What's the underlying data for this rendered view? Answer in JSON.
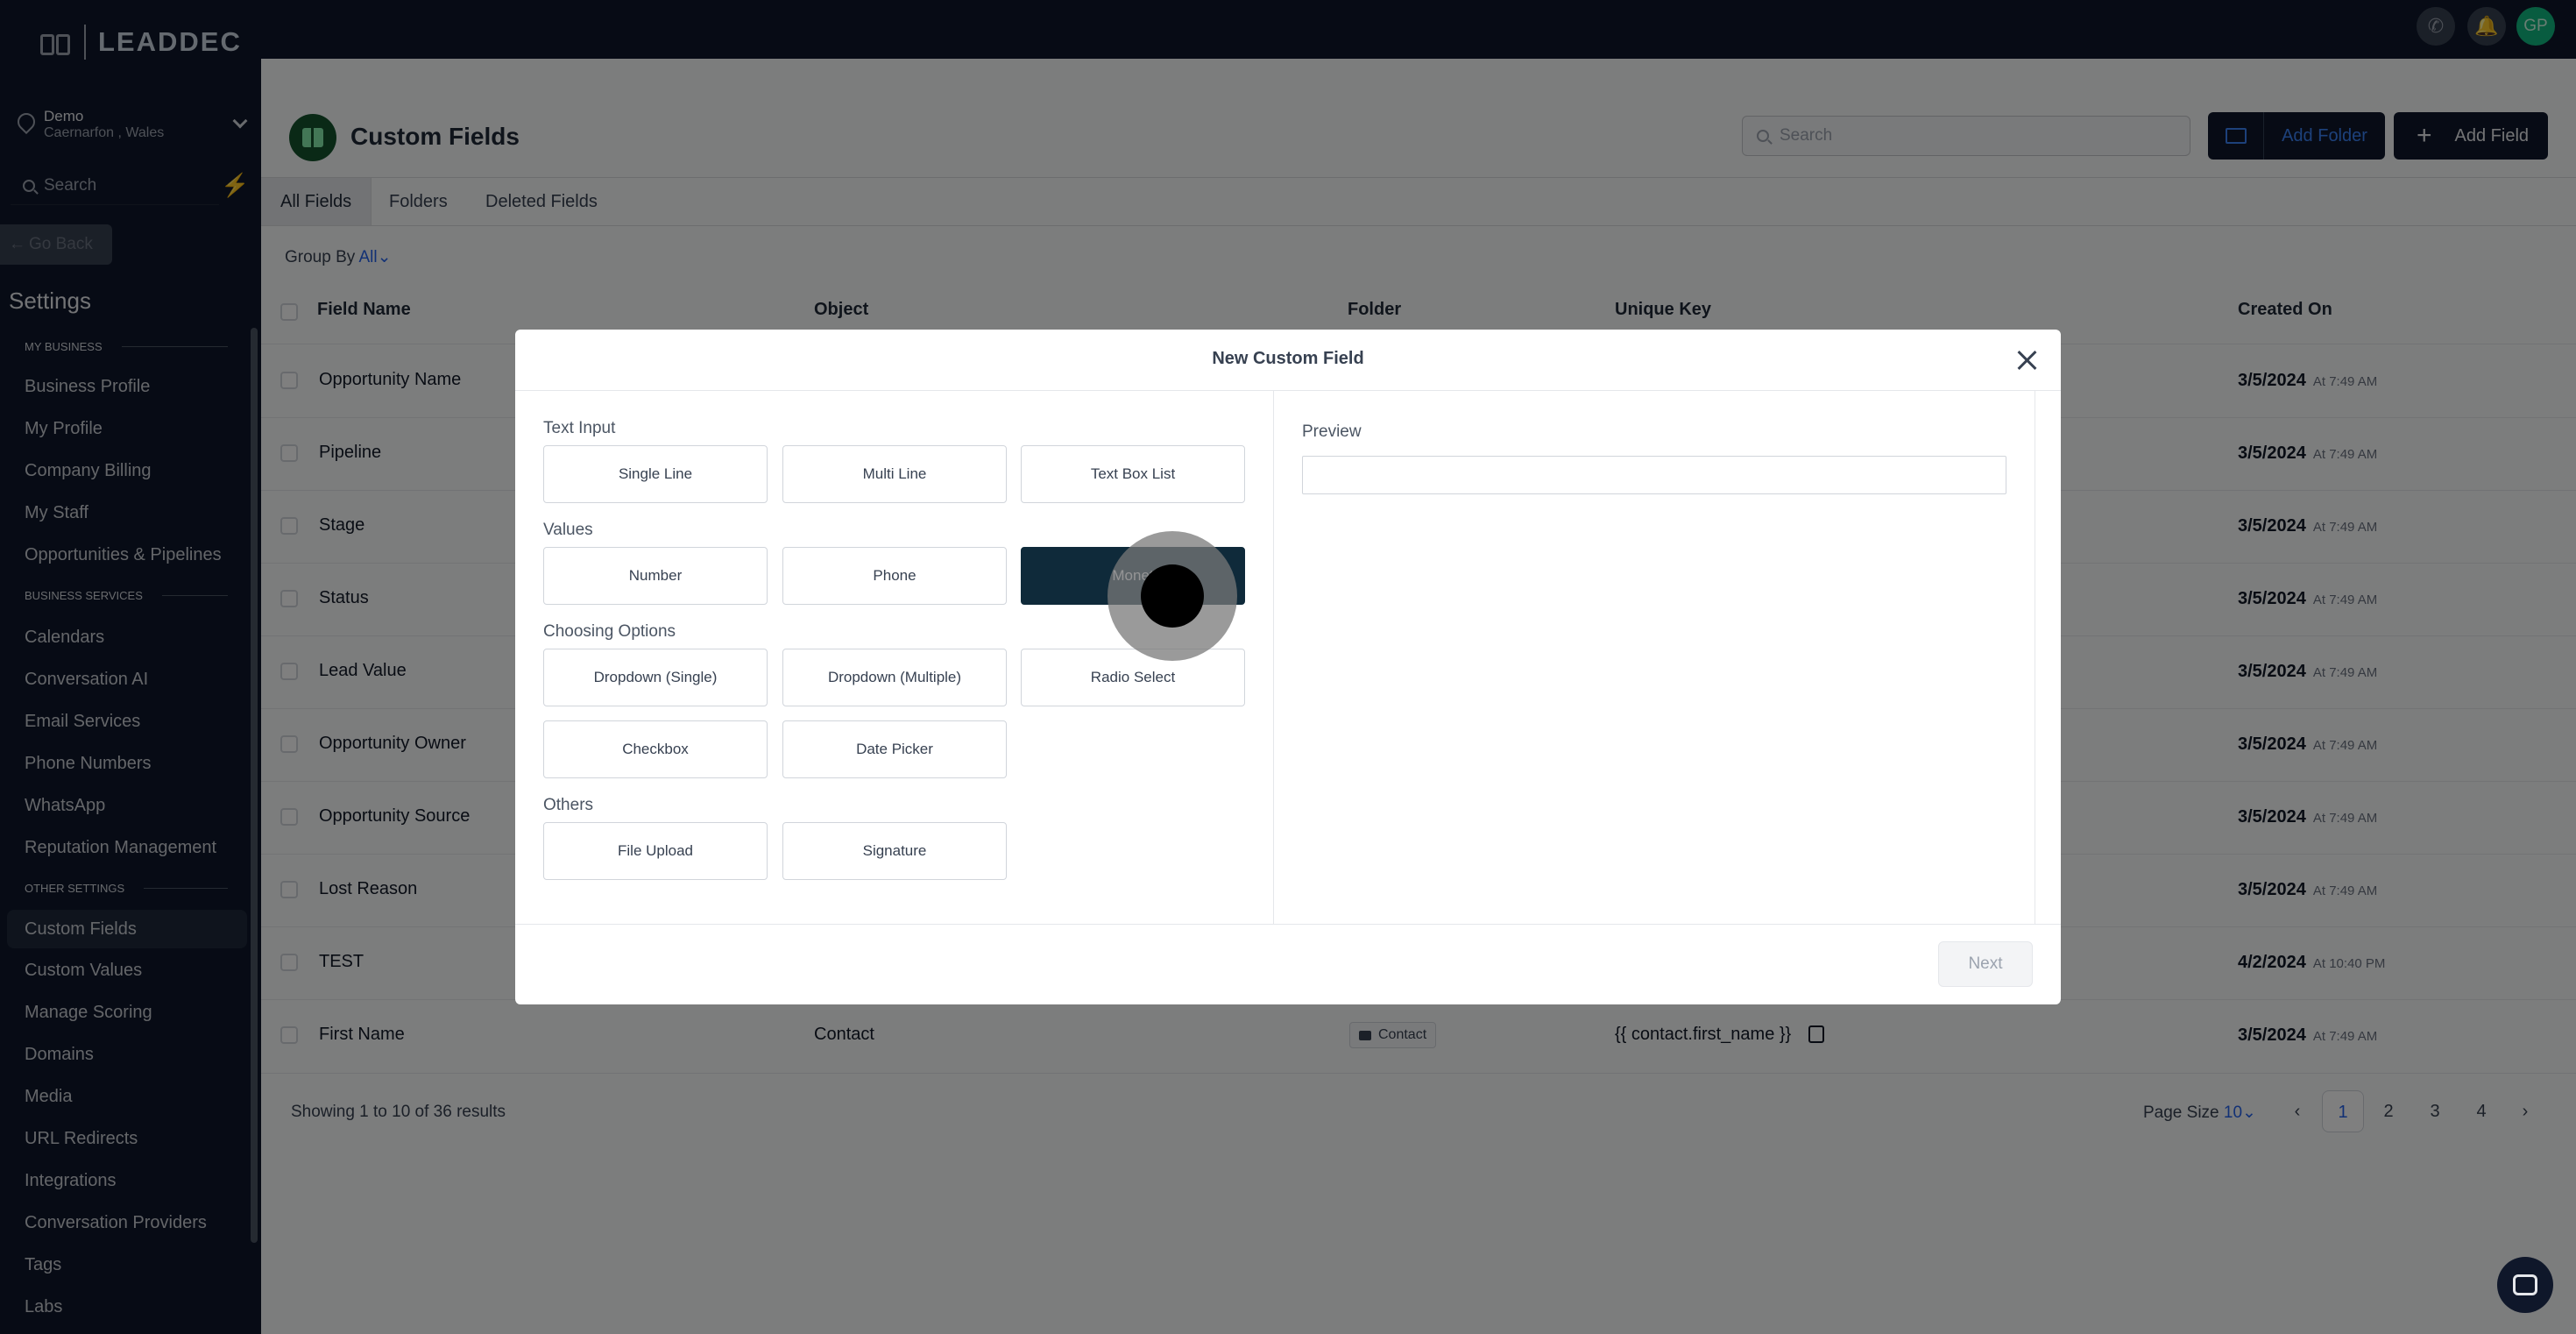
{
  "brand": {
    "logo_text": "LEADDEC"
  },
  "location": {
    "name": "Demo",
    "sub": "Caernarfon , Wales"
  },
  "sidebar": {
    "search_placeholder": "Search",
    "go_back": "Go Back",
    "settings_title": "Settings",
    "sections": [
      "MY BUSINESS",
      "BUSINESS SERVICES",
      "OTHER SETTINGS"
    ],
    "items": [
      "Business Profile",
      "My Profile",
      "Company Billing",
      "My Staff",
      "Opportunities & Pipelines",
      "Calendars",
      "Conversation AI",
      "Email Services",
      "Phone Numbers",
      "WhatsApp",
      "Reputation Management",
      "Custom Fields",
      "Custom Values",
      "Manage Scoring",
      "Domains",
      "Media",
      "URL Redirects",
      "Integrations",
      "Conversation Providers",
      "Tags",
      "Labs"
    ]
  },
  "topbar": {
    "avatar_initials": "GP"
  },
  "page": {
    "title": "Custom Fields",
    "search_placeholder": "Search",
    "add_folder": "Add Folder",
    "add_field": "Add Field",
    "tabs": [
      "All Fields",
      "Folders",
      "Deleted Fields"
    ],
    "group_by_label": "Group By",
    "group_by_value": "All"
  },
  "table": {
    "headers": [
      "Field Name",
      "Object",
      "Folder",
      "Unique Key",
      "Created On"
    ],
    "rows": [
      {
        "name": "Opportunity Name",
        "date": "3/5/2024",
        "time": "At 7:49 AM"
      },
      {
        "name": "Pipeline",
        "date": "3/5/2024",
        "time": "At 7:49 AM"
      },
      {
        "name": "Stage",
        "date": "3/5/2024",
        "time": "At 7:49 AM"
      },
      {
        "name": "Status",
        "date": "3/5/2024",
        "time": "At 7:49 AM"
      },
      {
        "name": "Lead Value",
        "date": "3/5/2024",
        "time": "At 7:49 AM"
      },
      {
        "name": "Opportunity Owner",
        "date": "3/5/2024",
        "time": "At 7:49 AM"
      },
      {
        "name": "Opportunity Source",
        "date": "3/5/2024",
        "time": "At 7:49 AM"
      },
      {
        "name": "Lost Reason",
        "date": "3/5/2024",
        "time": "At 7:49 AM"
      },
      {
        "name": "TEST",
        "date": "4/2/2024",
        "time": "At 10:40 PM"
      },
      {
        "name": "First Name",
        "object": "Contact",
        "folder": "Contact",
        "key": "{{ contact.first_name }}",
        "date": "3/5/2024",
        "time": "At 7:49 AM"
      }
    ],
    "showing": "Showing 1 to 10 of 36 results",
    "page_size_label": "Page Size",
    "page_size_value": "10",
    "pages": [
      "1",
      "2",
      "3",
      "4"
    ]
  },
  "modal": {
    "title": "New Custom Field",
    "groups": {
      "text_input": {
        "label": "Text Input",
        "options": [
          "Single Line",
          "Multi Line",
          "Text Box List"
        ]
      },
      "values": {
        "label": "Values",
        "options": [
          "Number",
          "Phone",
          "Monet"
        ]
      },
      "choosing": {
        "label": "Choosing Options",
        "options": [
          "Dropdown (Single)",
          "Dropdown (Multiple)",
          "Radio Select",
          "Checkbox",
          "Date Picker"
        ]
      },
      "others": {
        "label": "Others",
        "options": [
          "File Upload",
          "Signature"
        ]
      }
    },
    "selected_option": "Monet",
    "preview_label": "Preview",
    "next": "Next"
  }
}
